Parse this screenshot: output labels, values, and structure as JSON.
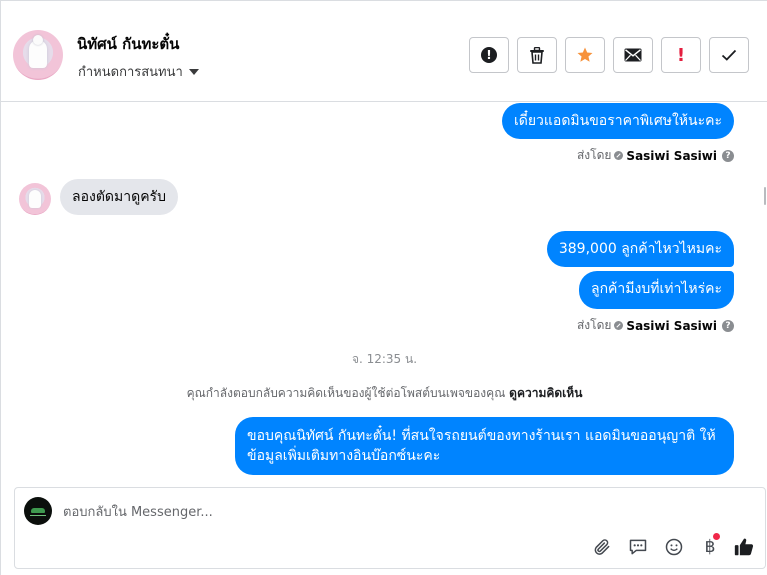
{
  "header": {
    "contact_name": "นิทัศน์ กันทะตั๋น",
    "subtitle": "กำหนดการสนทนา",
    "actions": [
      {
        "name": "report-icon"
      },
      {
        "name": "trash-icon"
      },
      {
        "name": "star-icon",
        "color": "#f7923b"
      },
      {
        "name": "envelope-icon"
      },
      {
        "name": "exclamation-icon",
        "color": "#e41e3f"
      },
      {
        "name": "check-icon"
      }
    ]
  },
  "conversation": {
    "messages": [
      {
        "direction": "out",
        "text": "เดี๋ยวแอดมินขอราคาพิเศษให้นะคะ"
      },
      {
        "direction": "in",
        "text": "ลองตัดมาดูครับ"
      },
      {
        "direction": "out",
        "text": "389,000 ลูกค้าไหวไหมคะ"
      },
      {
        "direction": "out",
        "text": "ลูกค้ามีงบที่เท่าไหร่คะ"
      },
      {
        "direction": "out",
        "text": "ขอบคุณนิทัศน์ กันทะตั๋น! ที่สนใจรถยนต์ของทางร้านเรา แอดมินขออนุญาติ ให้ข้อมูลเพิ่มเติมทางอินบ๊อกซ์นะคะ"
      }
    ],
    "sent_by_prefix": "ส่งโดย",
    "sent_by_name": "Sasiwi Sasiwi",
    "help_glyph": "?",
    "timestamp": "จ. 12:35 น.",
    "notice_text": "คุณกำลังตอบกลับความคิดเห็นของผู้ใช้ต่อโพสต์บนเพจของคุณ",
    "notice_link": "ดูความคิดเห็น",
    "accent_color": "#0084ff"
  },
  "composer": {
    "placeholder": "ตอบกลับใน Messenger...",
    "value": "",
    "tools": [
      "paperclip-icon",
      "speech-bubble-icon",
      "smiley-icon",
      "baht-icon",
      "thumbs-up-icon"
    ],
    "baht_glyph": "฿"
  }
}
